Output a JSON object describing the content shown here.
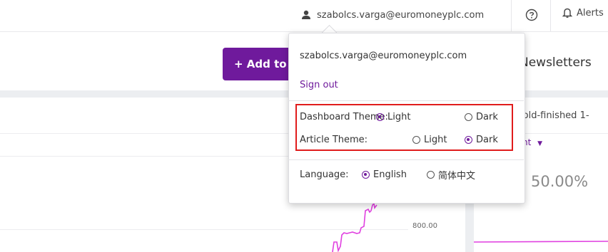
{
  "topbar": {
    "user_email": "szabolcs.varga@euromoneyplc.com",
    "user_icon": "person-icon",
    "help_icon": "question-circle-icon",
    "alerts_label": "Alerts",
    "alerts_icon": "bell-icon"
  },
  "toolbar": {
    "add_button_label": "+ Add to",
    "newsletters_label": "Newsletters",
    "accent_color": "#6f1a9c"
  },
  "dropdown": {
    "email": "szabolcs.varga@euromoneyplc.com",
    "sign_out_label": "Sign out",
    "dashboard_theme": {
      "label": "Dashboard Theme:",
      "options": [
        {
          "label": "Light",
          "selected": true
        },
        {
          "label": "Dark",
          "selected": false
        }
      ]
    },
    "article_theme": {
      "label": "Article Theme:",
      "options": [
        {
          "label": "Light",
          "selected": false
        },
        {
          "label": "Dark",
          "selected": true
        }
      ]
    },
    "language": {
      "label": "Language:",
      "options": [
        {
          "label": "English",
          "selected": true
        },
        {
          "label": "简体中文",
          "selected": false
        }
      ]
    },
    "highlight_color": "#e01c1c"
  },
  "left_chart": {
    "y_tick_label": "800.00",
    "line_color": "#e040e0"
  },
  "right_panel": {
    "description_text": "r cold-finished 1-",
    "metric_label": "nt",
    "value_text": "50.00%",
    "line_color": "#e040e0"
  }
}
